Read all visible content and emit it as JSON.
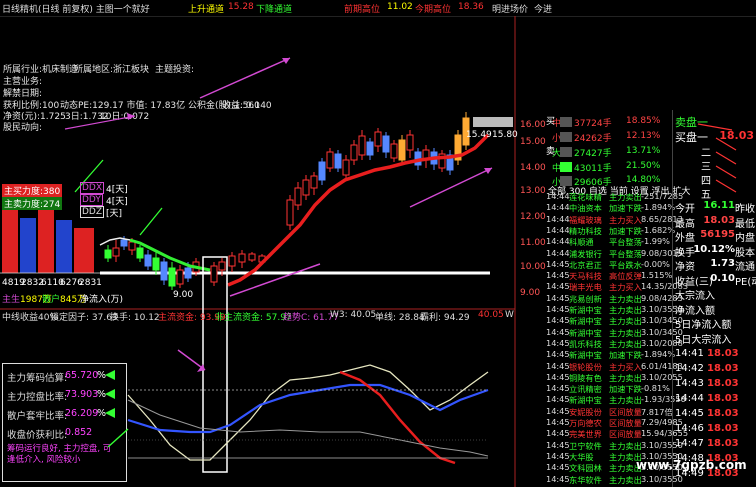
{
  "top_bar": {
    "title": "日线精机(日线 前复权) 主图一个就好",
    "uptrend_label": "上升通道",
    "uptrend_value": "15.28",
    "downtrend_label": "下降通道",
    "prev_high_label": "前期高位",
    "prev_high_value": "11.02",
    "today_high_label": "今期高位",
    "today_high_value": "18.36",
    "tomorrow_label": "明进场价",
    "tomorrow_value": "今进"
  },
  "info": {
    "industry": "所属行业:机床制造",
    "region": "所属地区:浙江板块",
    "theme": "主题投资:",
    "business": "主营业务:",
    "unlock_date": "解禁日期:",
    "profit_ratio": "获利比例:100",
    "pe_line": "动态PE:129.17 市值: 17.83亿 公积金(股):1.560",
    "income": "收益: 0.140",
    "net_assets": "净资(元):1.725",
    "shares": "3日:1.732",
    "ten_day": "10日:0.072",
    "holders": "股民动向:"
  },
  "left_labels": {
    "main_buy": "主买力度:380",
    "main_sell": "主卖力度:274",
    "ddx": "DDX",
    "ddx_days": "4[天]",
    "ddy": "DDY",
    "ddy_days": "4[天]",
    "ddz": "DDZ",
    "ddz_days": "[天]",
    "bar_values": [
      "4819",
      "2832",
      "6110",
      "6276",
      "2831"
    ],
    "flow_in_label": "主生",
    "flow_in": "1987万",
    "flow_out_label": "散户",
    "flow_out": "845万",
    "flow_unit": "净流入(万)"
  },
  "main_chart": {
    "price_labels": [
      {
        "text": "15.49",
        "color": "#ffffff"
      },
      {
        "text": "15.80",
        "color": "#ffffff"
      },
      {
        "text": "9.00",
        "color": "#ffffff"
      }
    ],
    "y_axis": [
      "16.00",
      "15.00",
      "14.00",
      "13.00",
      "12.00",
      "11.00",
      "10.00",
      "9.00"
    ]
  },
  "sub_title": {
    "main_profit": "中线收益40%",
    "lock": "锁定因子: 37.63",
    "hands": "换手: 10.12",
    "main_fund": "主流资金: 93.99",
    "non_main": "非主流资金: 57.97",
    "trend": "趋势C: 61.77",
    "w3": "W3: 40.05",
    "single": "单线: 28.84",
    "jx": "霸利: 94.29",
    "right": "40.05",
    "w": "W"
  },
  "sub_box": {
    "rows": [
      {
        "label": "主力筹码估算:",
        "value": "65.720",
        "pct": "%"
      },
      {
        "label": "主力控盘比率:",
        "value": "73.903",
        "pct": "%"
      },
      {
        "label": "散户套牢比率:",
        "value": "26.209",
        "pct": "%"
      },
      {
        "label": "收盘价获利比:",
        "value": "0.852",
        "pct": ""
      }
    ],
    "note": "筹码运行良好, 主力控盘, 可逢低介入, 风险较小"
  },
  "order_book": [
    {
      "side": "中",
      "color": "#ff4444",
      "value": "37724手",
      "pct": "18.85%"
    },
    {
      "side": "小",
      "color": "#ff4444",
      "value": "24262手",
      "pct": "12.13%"
    },
    {
      "side": "大",
      "color": "#3f3",
      "value": "27427手",
      "pct": "13.71%"
    },
    {
      "side": "中",
      "color": "#3f3",
      "value": "43011手",
      "pct": "21.50%"
    },
    {
      "side": "小",
      "color": "#3f3",
      "value": "29606手",
      "pct": "14.80%"
    }
  ],
  "book_labels": {
    "buy": "买",
    "sell": "卖",
    "into": "入",
    "out": "出"
  },
  "toolbar": {
    "label": "全部 300 自选 当前 设置 浮出 扩大"
  },
  "ticks": [
    {
      "time": "14:44",
      "name": "莲花味精",
      "type": "主力卖出",
      "val": "-251/7285"
    },
    {
      "time": "14:44",
      "name": "中油资本",
      "type": "加速下跌",
      "val": "-1.894%"
    },
    {
      "time": "14:44",
      "name": "福耀玻璃",
      "type": "主力买入",
      "val": "8.65/2813"
    },
    {
      "time": "14:44",
      "name": "精功科技",
      "type": "加速下跌",
      "val": "-1.682%"
    },
    {
      "time": "14:44",
      "name": "科顺通",
      "type": "平台整荡",
      "val": "-1.99%"
    },
    {
      "time": "14:44",
      "name": "浦发银行",
      "type": "平台整荡",
      "val": "9.08/3015"
    },
    {
      "time": "14:45",
      "name": "北京君正",
      "type": "平台跌水",
      "val": "-0.00%"
    },
    {
      "time": "14:45",
      "name": "天马科技",
      "type": "高位反弹",
      "val": "1.515%"
    },
    {
      "time": "14:45",
      "name": "瑞丰光电",
      "type": "主力买入",
      "val": "14.35/2083"
    },
    {
      "time": "14:45",
      "name": "兆易创新",
      "type": "主力卖出",
      "val": "9.08/4283"
    },
    {
      "time": "14:45",
      "name": "新湖中宝",
      "type": "主力卖出",
      "val": "3.10/3550"
    },
    {
      "time": "14:45",
      "name": "新湖中宝",
      "type": "主力卖出",
      "val": "3.10/3450"
    },
    {
      "time": "14:45",
      "name": "新湖中宝",
      "type": "主力卖出",
      "val": "3.10/3450"
    },
    {
      "time": "14:45",
      "name": "凯乐科技",
      "type": "主力卖出",
      "val": "3.10/2088"
    },
    {
      "time": "14:45",
      "name": "新湖中宝",
      "type": "加速下跌",
      "val": "-1.894%"
    },
    {
      "time": "14:45",
      "name": "银轮股份",
      "type": "主力买入",
      "val": "6.01/4183"
    },
    {
      "time": "14:45",
      "name": "铜陵有色",
      "type": "主力卖出",
      "val": "3.10/2055"
    },
    {
      "time": "14:45",
      "name": "立讯精密",
      "type": "加速下跌",
      "val": "-0.81%"
    },
    {
      "time": "14:45",
      "name": "新湖中宝",
      "type": "主力卖出",
      "val": "-1.93/3550"
    },
    {
      "time": "14:45",
      "name": "安妮股份",
      "type": "区间放量",
      "val": "7.817倍"
    },
    {
      "time": "14:45",
      "name": "万向德农",
      "type": "区间放量",
      "val": "7.29/4985"
    },
    {
      "time": "14:45",
      "name": "完美世界",
      "type": "区间放量",
      "val": "15.94/3655"
    },
    {
      "time": "14:45",
      "name": "卫宁软件",
      "type": "主力卖出",
      "val": "3.10/3550"
    },
    {
      "time": "14:45",
      "name": "大华股",
      "type": "主力卖出",
      "val": "3.10/3550"
    },
    {
      "time": "14:45",
      "name": "文科园林",
      "type": "主力卖出",
      "val": "3.10/3550"
    },
    {
      "time": "14:45",
      "name": "东华软件",
      "type": "主力卖出",
      "val": "3.10/3550"
    }
  ],
  "quote": {
    "sell_label": "卖盘一",
    "buy_label": "买盘一",
    "buy_value": "18.03",
    "levels": [
      "二",
      "三",
      "四",
      "五"
    ],
    "rows": [
      {
        "label": "今开",
        "value": "16.11",
        "label2": "昨收",
        "color": "#3f3"
      },
      {
        "label": "最高",
        "value": "18.03",
        "label2": "最低",
        "color": "#ff4444"
      },
      {
        "label": "外盘",
        "value": "56195",
        "label2": "内盘",
        "color": "#ff4444"
      },
      {
        "label": "换手",
        "value": "10.12%",
        "label2": "股本",
        "color": "#fff"
      },
      {
        "label": "净资",
        "value": "1.73",
        "label2": "流通",
        "color": "#fff"
      },
      {
        "label": "收益(三)",
        "value": "0.10",
        "label2": "PE(动)",
        "color": "#fff"
      },
      {
        "label": "大宗流入",
        "value": "",
        "label2": "",
        "color": "#fff"
      },
      {
        "label": "净流入额",
        "value": "",
        "label2": "",
        "color": "#fff"
      },
      {
        "label": "5日净流入额",
        "value": "",
        "label2": "",
        "color": "#fff"
      },
      {
        "label": "5日大宗流入",
        "value": "",
        "label2": "",
        "color": "#fff"
      }
    ],
    "trades": [
      {
        "time": "14:41",
        "price": "18.03"
      },
      {
        "time": "14:42",
        "price": "18.03"
      },
      {
        "time": "14:43",
        "price": "18.03"
      },
      {
        "time": "14:44",
        "price": "18.03"
      },
      {
        "time": "14:45",
        "price": "18.03"
      },
      {
        "time": "14:46",
        "price": "18.03"
      },
      {
        "time": "14:47",
        "price": "18.03"
      },
      {
        "time": "14:48",
        "price": "18.03"
      },
      {
        "time": "14:49",
        "price": "18.03"
      }
    ]
  },
  "watermark": "www.7gpzb.com"
}
